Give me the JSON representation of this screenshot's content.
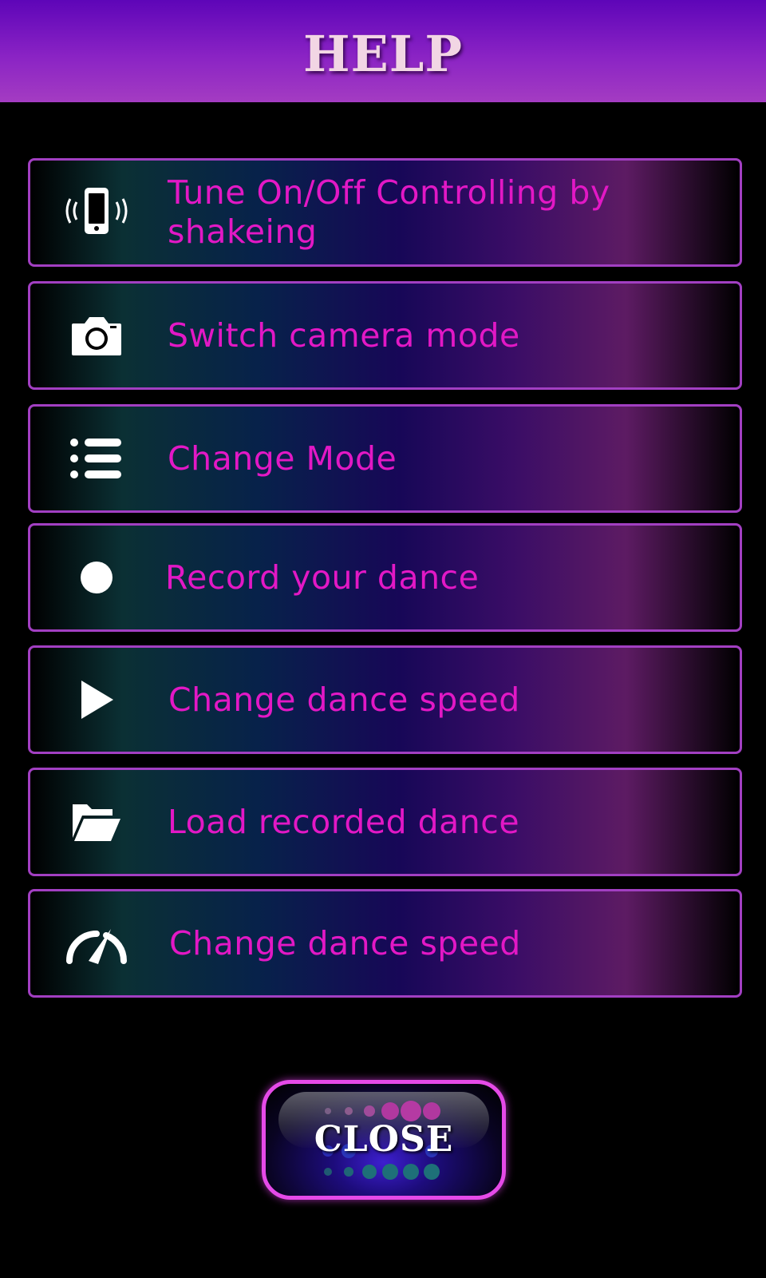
{
  "header": {
    "title": "HELP"
  },
  "help_items": [
    {
      "icon": "phone-shake-icon",
      "label": "Tune On/Off Controlling by shakeing"
    },
    {
      "icon": "camera-icon",
      "label": "Switch camera mode"
    },
    {
      "icon": "list-icon",
      "label": "Change Mode"
    },
    {
      "icon": "record-icon",
      "label": "Record your dance"
    },
    {
      "icon": "play-icon",
      "label": "Change dance speed"
    },
    {
      "icon": "folder-open-icon",
      "label": "Load recorded dance"
    },
    {
      "icon": "speedometer-icon",
      "label": "Change dance speed"
    }
  ],
  "close_button": {
    "label": "CLOSE"
  },
  "colors": {
    "label_text": "#e218c5",
    "row_border": "#a23fc2",
    "header_top": "#5e05b8",
    "header_bottom": "#a43cc2",
    "close_border": "#e54ae8"
  }
}
